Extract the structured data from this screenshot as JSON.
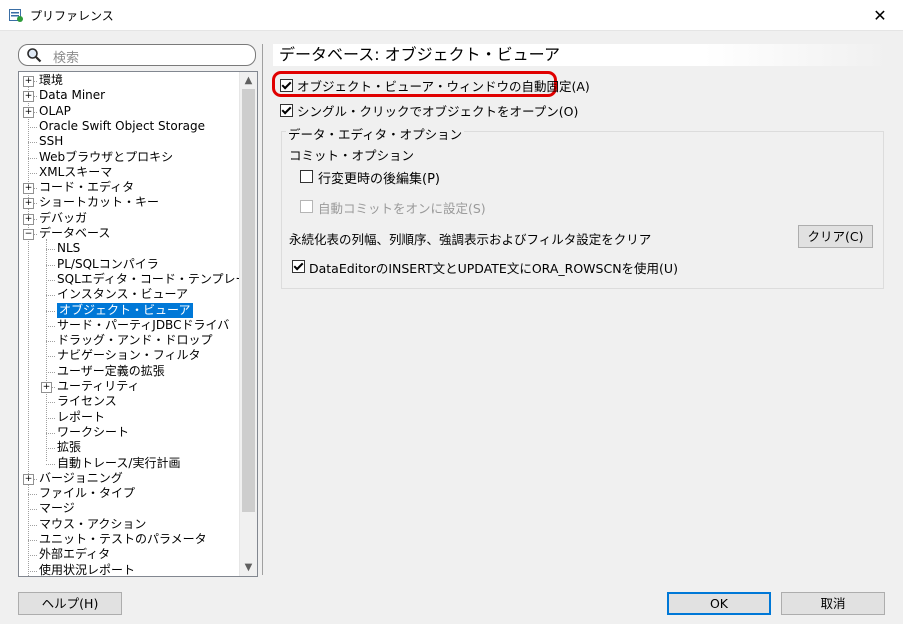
{
  "window": {
    "title": "プリファレンス"
  },
  "search": {
    "placeholder": "検索"
  },
  "tree": {
    "items": [
      {
        "label": "環境"
      },
      {
        "label": "Data Miner"
      },
      {
        "label": "OLAP"
      },
      {
        "label": "Oracle Swift Object Storage"
      },
      {
        "label": "SSH"
      },
      {
        "label": "Webブラウザとプロキシ"
      },
      {
        "label": "XMLスキーマ"
      },
      {
        "label": "コード・エディタ"
      },
      {
        "label": "ショートカット・キー"
      },
      {
        "label": "デバッガ"
      },
      {
        "label": "データベース"
      },
      {
        "label": "NLS"
      },
      {
        "label": "PL/SQLコンパイラ"
      },
      {
        "label": "SQLエディタ・コード・テンプレート"
      },
      {
        "label": "インスタンス・ビューア"
      },
      {
        "label": "オブジェクト・ビューア"
      },
      {
        "label": "サード・パーティJDBCドライバ"
      },
      {
        "label": "ドラッグ・アンド・ドロップ"
      },
      {
        "label": "ナビゲーション・フィルタ"
      },
      {
        "label": "ユーザー定義の拡張"
      },
      {
        "label": "ユーティリティ"
      },
      {
        "label": "ライセンス"
      },
      {
        "label": "レポート"
      },
      {
        "label": "ワークシート"
      },
      {
        "label": "拡張"
      },
      {
        "label": "自動トレース/実行計画"
      },
      {
        "label": "バージョニング"
      },
      {
        "label": "ファイル・タイプ"
      },
      {
        "label": "マージ"
      },
      {
        "label": "マウス・アクション"
      },
      {
        "label": "ユニット・テストのパラメータ"
      },
      {
        "label": "外部エディタ"
      },
      {
        "label": "使用状況レポート"
      }
    ],
    "selected": "オブジェクト・ビューア"
  },
  "panel": {
    "title": "データベース: オブジェクト・ビューア",
    "auto_pin": {
      "label": "オブジェクト・ビューア・ウィンドウの自動固定(A)",
      "checked": true
    },
    "single_click": {
      "label": "シングル・クリックでオブジェクトをオープン(O)",
      "checked": true
    },
    "data_editor_group": {
      "title": "データ・エディタ・オプション",
      "commit_label": "コミット・オプション",
      "post_edit": {
        "label": "行変更時の後編集(P)",
        "checked": false
      },
      "auto_commit": {
        "label": "自動コミットをオンに設定(S)",
        "checked": false,
        "disabled": true
      },
      "persist_text": "永続化表の列幅、列順序、強調表示およびフィルタ設定をクリア",
      "clear_button": "クリア(C)",
      "rowscn": {
        "label": "DataEditorのINSERT文とUPDATE文にORA_ROWSCNを使用(U)",
        "checked": true
      }
    }
  },
  "footer": {
    "help_button": "ヘルプ(H)",
    "ok_button": "OK",
    "cancel_button": "取消"
  },
  "colors": {
    "selection": "#0078d7",
    "highlight_outline": "#e00000"
  }
}
